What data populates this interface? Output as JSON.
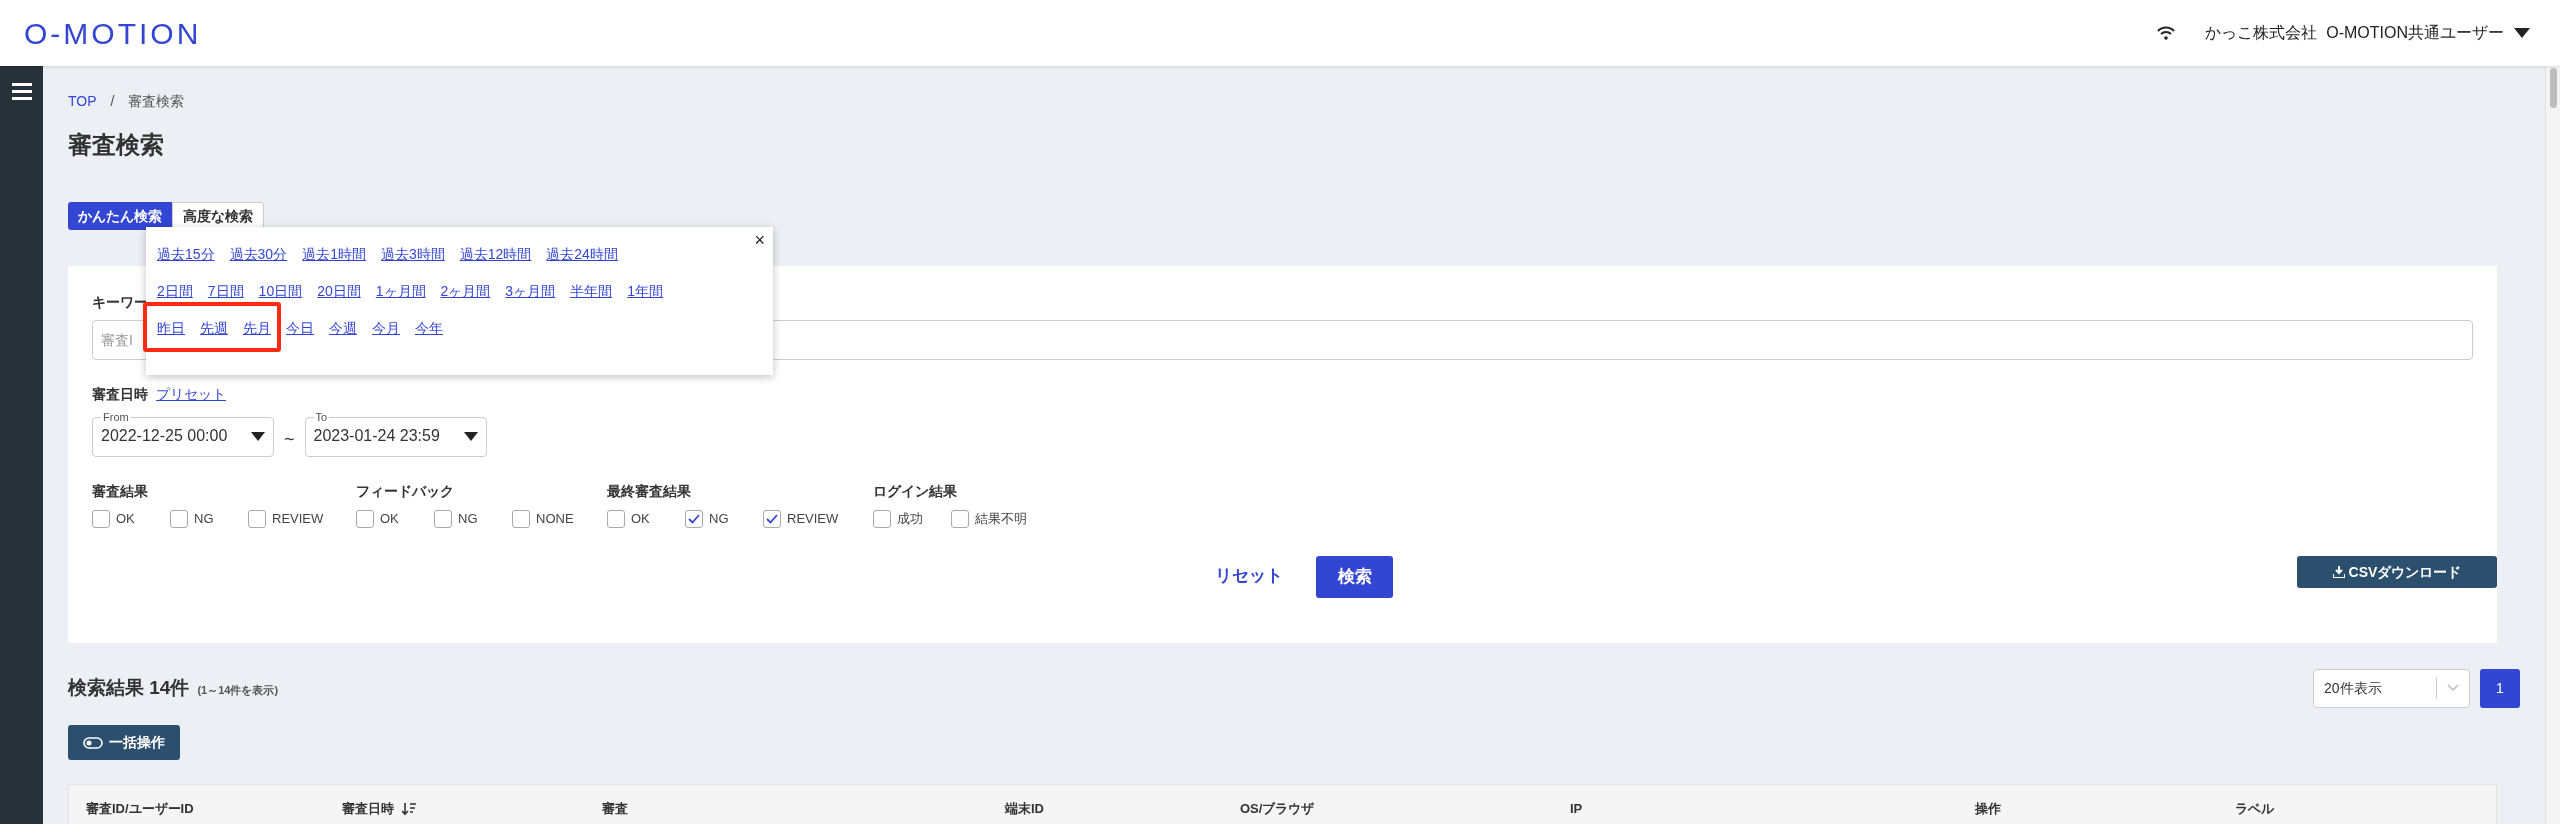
{
  "header": {
    "logo": "O-MOTION",
    "user": "かっこ株式会社  O-MOTION共通ユーザー"
  },
  "breadcrumb": {
    "link": "TOP",
    "separator": "/",
    "current": "審査検索"
  },
  "page_title": "審査検索",
  "tabs": [
    {
      "label": "かんたん検索",
      "selected": true
    },
    {
      "label": "高度な検索",
      "selected": false
    }
  ],
  "preset_popup": {
    "groups": [
      {
        "links": [
          "過去15分",
          "過去30分",
          "過去1時間",
          "過去3時間",
          "過去12時間",
          "過去24時間"
        ]
      },
      {
        "links": [
          "2日間",
          "7日間",
          "10日間",
          "20日間",
          "1ヶ月間",
          "2ヶ月間",
          "3ヶ月間",
          "半年間",
          "1年間"
        ]
      },
      {
        "links": [
          "昨日",
          "先週",
          "先月",
          "今日",
          "今週",
          "今月",
          "今年"
        ]
      }
    ],
    "close": "×"
  },
  "keyword": {
    "label": "キーワー",
    "placeholder": "審査I"
  },
  "date": {
    "label": "審査日時",
    "preset_link": "プリセット",
    "from_label": "From",
    "from": "2022-12-25 00:00",
    "separator": "~",
    "to_label": "To",
    "to": "2023-01-24 23:59"
  },
  "filters": [
    {
      "label": "審査結果",
      "options": [
        {
          "label": "OK",
          "checked": false
        },
        {
          "label": "NG",
          "checked": false
        },
        {
          "label": "REVIEW",
          "checked": false
        }
      ]
    },
    {
      "label": "フィードバック",
      "options": [
        {
          "label": "OK",
          "checked": false
        },
        {
          "label": "NG",
          "checked": false
        },
        {
          "label": "NONE",
          "checked": false
        }
      ]
    },
    {
      "label": "最終審査結果",
      "options": [
        {
          "label": "OK",
          "checked": false
        },
        {
          "label": "NG",
          "checked": true
        },
        {
          "label": "REVIEW",
          "checked": true
        }
      ]
    },
    {
      "label": "ログイン結果",
      "options": [
        {
          "label": "成功",
          "checked": false
        },
        {
          "label": "結果不明",
          "checked": false
        }
      ]
    }
  ],
  "actions": {
    "reset": "リセット",
    "search": "検索",
    "csv": "CSVダウンロード"
  },
  "results": {
    "title": "検索結果 14件",
    "range": "(1～14件を表示)",
    "page_size": "20件表示",
    "pages": [
      {
        "label": "1",
        "selected": true
      }
    ],
    "bulk": "一括操作"
  },
  "table": {
    "columns": [
      {
        "label": "審査ID/ユーザーID",
        "sorted": false
      },
      {
        "label": "審査日時",
        "sorted": true
      },
      {
        "label": "審査",
        "sorted": false
      },
      {
        "label": "端末ID",
        "sorted": false
      },
      {
        "label": "OS/ブラウザ",
        "sorted": false
      },
      {
        "label": "IP",
        "sorted": false
      },
      {
        "label": "操作",
        "sorted": false
      },
      {
        "label": "ラベル",
        "sorted": false
      }
    ]
  }
}
